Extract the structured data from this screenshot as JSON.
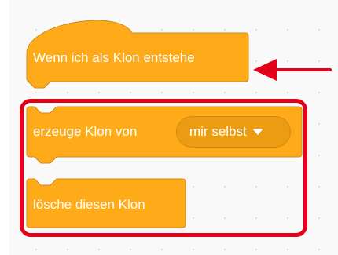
{
  "blocks": {
    "hat_label": "Wenn ich als Klon entstehe",
    "create_clone_label": "erzeuge Klon von",
    "create_clone_menu_value": "mir selbst",
    "delete_clone_label": "lösche diesen Klon"
  },
  "colors": {
    "block_fill": "#ffab19",
    "block_stroke": "#cf8b17",
    "dropdown_fill": "#ec9c13",
    "highlight": "#e5001a"
  },
  "icons": {
    "dropdown": "caret-down-icon",
    "pointer": "arrow-left-icon"
  }
}
